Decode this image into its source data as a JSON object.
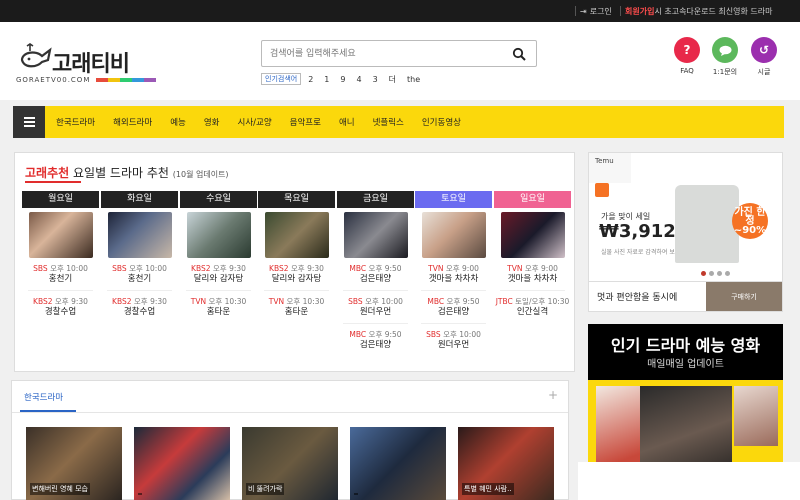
{
  "topbar": {
    "login": "로그인",
    "signup_bold": "회원가입",
    "signup_rest": "시 초고속다운로드 최신영화 드라마"
  },
  "logo": {
    "name": "고래티비",
    "domain": "GORAETV00.COM",
    "bar_colors": [
      "#e74c3c",
      "#f1c40f",
      "#2ecc71",
      "#3498db",
      "#9b59b6"
    ]
  },
  "search": {
    "placeholder": "검색어를 입력해주세요",
    "keywords_label": "인기검색어",
    "keywords": [
      "2",
      "1",
      "9",
      "4",
      "3",
      "더",
      "the"
    ]
  },
  "header_buttons": [
    {
      "label": "FAQ",
      "glyph": "?",
      "color": "#e8294a"
    },
    {
      "label": "1:1문의",
      "glyph": "chat",
      "color": "#5cb85c"
    },
    {
      "label": "시글",
      "glyph": "↺",
      "color": "#9b2fae"
    }
  ],
  "nav": {
    "items": [
      "한국드라마",
      "해외드라마",
      "예능",
      "영화",
      "시사/교양",
      "음악프로",
      "애니",
      "넷플릭스",
      "인기동영상"
    ]
  },
  "recommend": {
    "title_red": "고래추천",
    "title": "요일별 드라마 추천",
    "subtitle": "(10월 업데이트)",
    "days": [
      {
        "day": "월요일",
        "color": "#222222",
        "shows": [
          {
            "channel": "SBS",
            "time": "오후 10:00",
            "name": "홍천기"
          },
          {
            "channel": "KBS2",
            "time": "오후 9:30",
            "name": "경찰수업"
          }
        ]
      },
      {
        "day": "화요일",
        "color": "#222222",
        "shows": [
          {
            "channel": "SBS",
            "time": "오후 10:00",
            "name": "홍천기"
          },
          {
            "channel": "KBS2",
            "time": "오후 9:30",
            "name": "경찰수업"
          }
        ]
      },
      {
        "day": "수요일",
        "color": "#222222",
        "shows": [
          {
            "channel": "KBS2",
            "time": "오후 9:30",
            "name": "달리와 감자탕"
          },
          {
            "channel": "TVN",
            "time": "오후 10:30",
            "name": "홈타운"
          }
        ]
      },
      {
        "day": "목요일",
        "color": "#222222",
        "shows": [
          {
            "channel": "KBS2",
            "time": "오후 9:30",
            "name": "달리와 감자탕"
          },
          {
            "channel": "TVN",
            "time": "오후 10:30",
            "name": "홈타운"
          }
        ]
      },
      {
        "day": "금요일",
        "color": "#222222",
        "shows": [
          {
            "channel": "MBC",
            "time": "오후 9:50",
            "name": "검은태양"
          },
          {
            "channel": "SBS",
            "time": "오후 10:00",
            "name": "원더우먼"
          },
          {
            "channel": "MBC",
            "time": "오후 9:50",
            "name": "검은태양"
          }
        ]
      },
      {
        "day": "토요일",
        "color": "#6b6bf0",
        "shows": [
          {
            "channel": "TVN",
            "time": "오후 9:00",
            "name": "갯마을 차차차"
          },
          {
            "channel": "MBC",
            "time": "오후 9:50",
            "name": "검은태양"
          },
          {
            "channel": "SBS",
            "time": "오후 10:00",
            "name": "원더우먼"
          }
        ]
      },
      {
        "day": "일요일",
        "color": "#f06292",
        "shows": [
          {
            "channel": "TVN",
            "time": "오후 9:00",
            "name": "갯마을 차차차"
          },
          {
            "channel": "JTBC",
            "time": "토일/오후 10:30",
            "name": "인간실격"
          }
        ]
      }
    ]
  },
  "korean_drama": {
    "tab": "한국드라마",
    "plus": "+",
    "thumbs": [
      {
        "caption": "변해버린 영혜 모습"
      },
      {
        "caption": ""
      },
      {
        "caption": "비 뚫려가락"
      },
      {
        "caption": ""
      },
      {
        "caption": "특별 혜민 사람.."
      }
    ]
  },
  "ads": {
    "temu": {
      "brand": "Temu",
      "headline": "가을 맞이 세일",
      "price": "₩3,912",
      "fine": "실물 사진 자료로 감격하여 보여드립니다",
      "badge": "가진 한정 ~90%",
      "footer": "멋과 편안함을 동시에",
      "button": "구매하기"
    },
    "popular": {
      "line1": "인기 드라마 예능 영화",
      "line2": "매일매일 업데이트"
    }
  }
}
